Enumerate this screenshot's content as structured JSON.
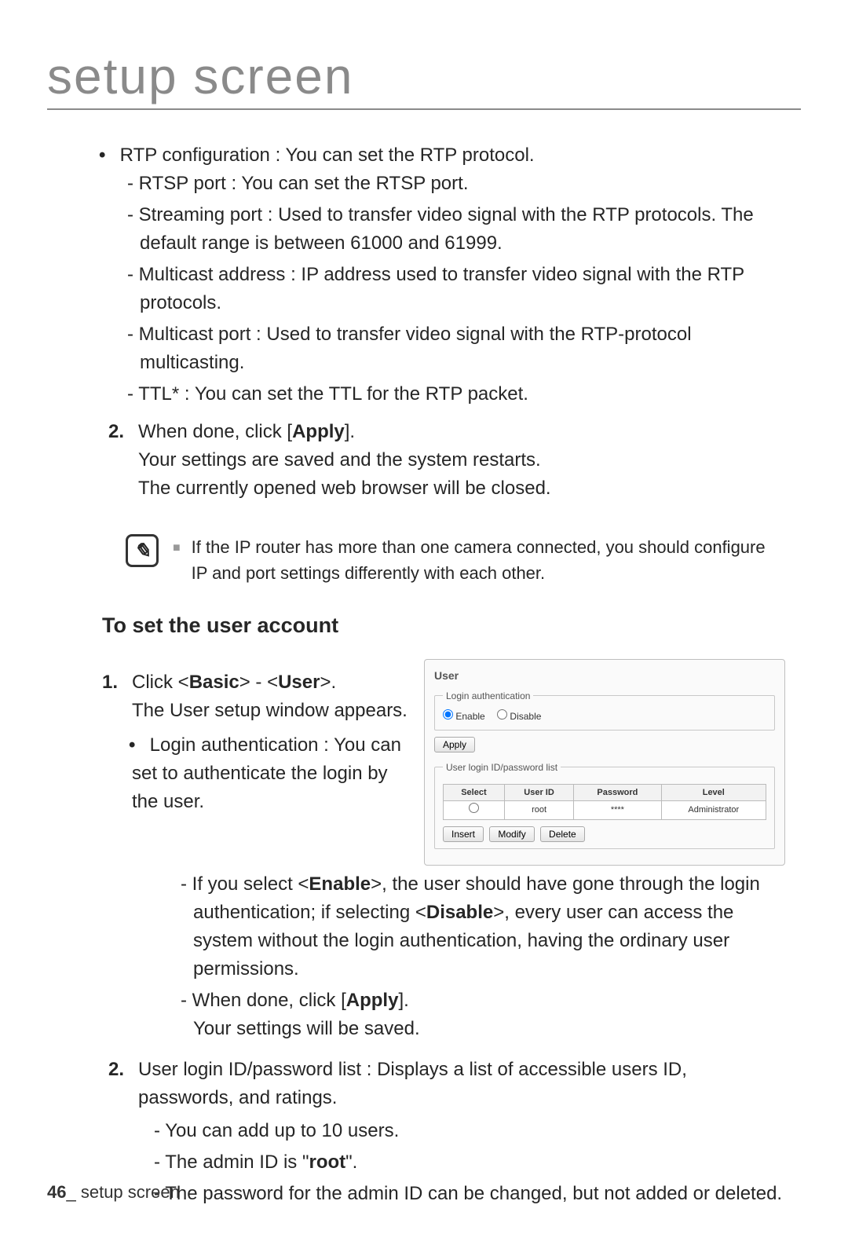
{
  "page": {
    "title": "setup screen",
    "page_number": "46",
    "footer_label": "setup screen"
  },
  "rtp": {
    "intro": "RTP configuration : You can set the RTP protocol.",
    "items": [
      "RTSP port : You can set the RTSP port.",
      "Streaming port : Used to transfer video signal with the RTP protocols. The default range is between 61000 and 61999.",
      "Multicast address : IP address used to transfer video signal with the RTP protocols.",
      "Multicast port : Used to transfer video signal with the RTP-protocol multicasting.",
      "TTL* : You can set the TTL for the RTP packet."
    ]
  },
  "step2": {
    "num": "2.",
    "line1_a": "When done, click [",
    "line1_b": "Apply",
    "line1_c": "].",
    "line2": "Your settings are saved and the system restarts.",
    "line3": "The currently opened web browser will be closed."
  },
  "note": {
    "text": "If the IP router has more than one camera connected, you should configure IP and port settings differently with each other."
  },
  "user_section": {
    "heading": "To set the user account",
    "s1": {
      "num": "1.",
      "l1a": "Click <",
      "l1b": "Basic",
      "l1c": "> - <",
      "l1d": "User",
      "l1e": ">.",
      "l2": "The User setup window appears.",
      "bullet": "Login authentication : You can set to authenticate the login by the user.",
      "d1a": "If you select <",
      "d1b": "Enable",
      "d1c": ">, the user should have gone through the login authentication; if selecting <",
      "d1d": "Disable",
      "d1e": ">, every user can access the system without the login authentication, having the ordinary user permissions.",
      "d2a": "When done, click [",
      "d2b": "Apply",
      "d2c": "].",
      "d2line2": "Your settings will be saved."
    },
    "s2": {
      "num": "2.",
      "text": "User login ID/password list : Displays a list of accessible users ID, passwords, and ratings.",
      "items_a": "You can add up to 10 users.",
      "items_b_pre": "The admin ID is \"",
      "items_b_bold": "root",
      "items_b_post": "\".",
      "items_c": "The password for the admin ID can be changed, but not added or deleted."
    }
  },
  "panel": {
    "title": "User",
    "fs1_legend": "Login authentication",
    "enable": "Enable",
    "disable": "Disable",
    "apply": "Apply",
    "fs2_legend": "User login ID/password list",
    "th_select": "Select",
    "th_uid": "User ID",
    "th_pwd": "Password",
    "th_level": "Level",
    "row_uid": "root",
    "row_pwd": "****",
    "row_level": "Administrator",
    "insert": "Insert",
    "modify": "Modify",
    "delete": "Delete"
  }
}
